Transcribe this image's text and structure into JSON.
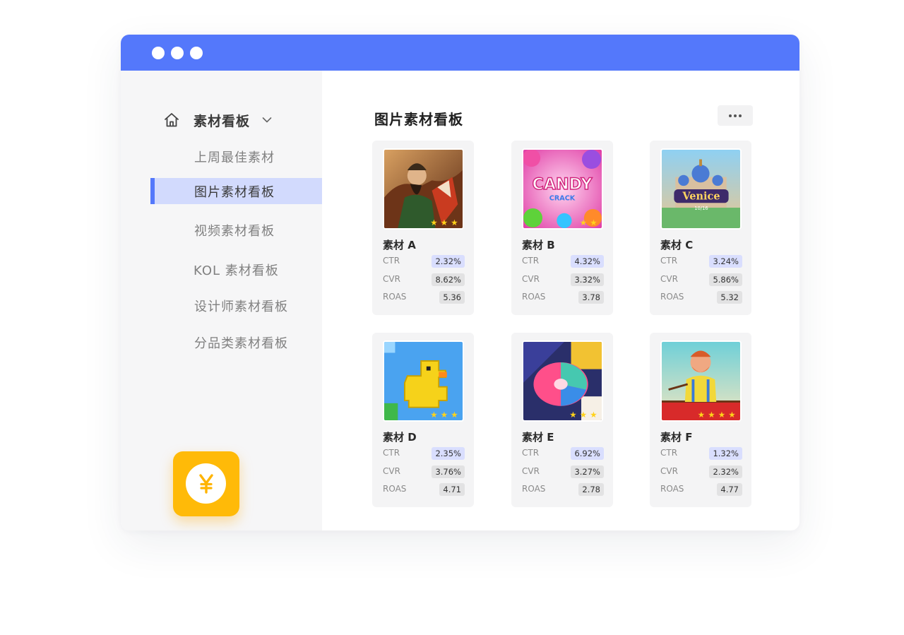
{
  "window": {
    "titlebar_color": "#5478fb",
    "dots": [
      "window-dot-1",
      "window-dot-2",
      "window-dot-3"
    ]
  },
  "sidebar": {
    "group": {
      "icon": "home-icon",
      "label": "素材看板",
      "chevron": "chevron-down-icon"
    },
    "items": [
      {
        "label": "上周最佳素材",
        "active": false
      },
      {
        "label": "图片素材看板",
        "active": true
      },
      {
        "label": "视频素材看板",
        "active": false
      },
      {
        "label": "KOL 素材看板",
        "active": false
      },
      {
        "label": "设计师素材看板",
        "active": false
      },
      {
        "label": "分品类素材看板",
        "active": false
      }
    ],
    "badge": {
      "icon": "yuan-icon",
      "color": "#ffba08"
    }
  },
  "main": {
    "title": "图片素材看板",
    "more_icon": "more-dots-icon",
    "metric_labels": {
      "ctr": "CTR",
      "cvr": "CVR",
      "roas": "ROAS"
    },
    "cards": [
      {
        "name": "素材 A",
        "ctr": "2.32%",
        "cvr": "8.62%",
        "roas": "5.36",
        "stars": 3
      },
      {
        "name": "素材 B",
        "ctr": "4.32%",
        "cvr": "3.32%",
        "roas": "3.78",
        "stars": 2,
        "thumb_text": {
          "title": "CANDY",
          "sub": "CRACK"
        }
      },
      {
        "name": "素材 C",
        "ctr": "3.24%",
        "cvr": "5.86%",
        "roas": "5.32",
        "stars": 0,
        "thumb_text": {
          "title": "Venice",
          "sub": "10/16"
        }
      },
      {
        "name": "素材 D",
        "ctr": "2.35%",
        "cvr": "3.76%",
        "roas": "4.71",
        "stars": 3
      },
      {
        "name": "素材 E",
        "ctr": "6.92%",
        "cvr": "3.27%",
        "roas": "2.78",
        "stars": 3
      },
      {
        "name": "素材 F",
        "ctr": "1.32%",
        "cvr": "2.32%",
        "roas": "4.77",
        "stars": 4
      }
    ]
  }
}
